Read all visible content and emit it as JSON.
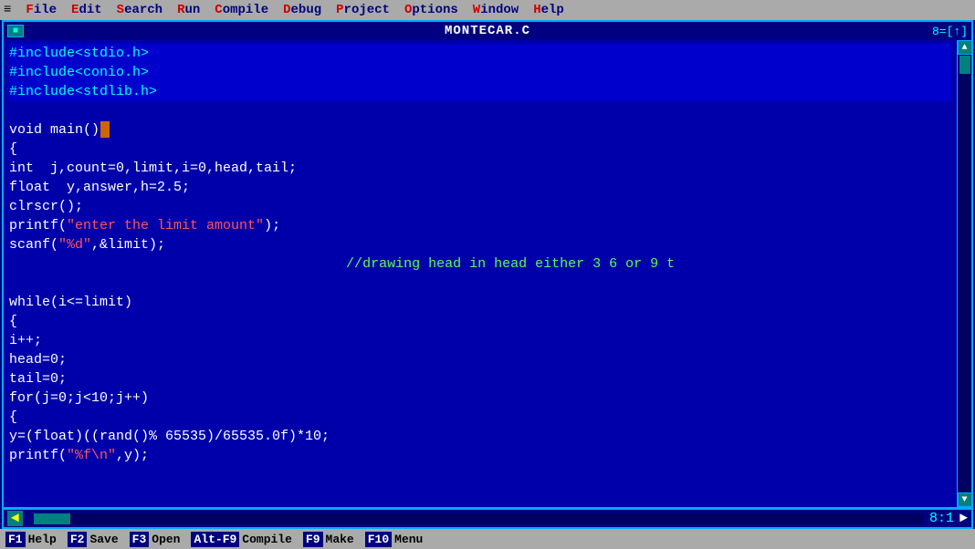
{
  "menubar": {
    "icon": "≡",
    "items": [
      {
        "label": "File",
        "first": "F"
      },
      {
        "label": "Edit",
        "first": "E"
      },
      {
        "label": "Search",
        "first": "S"
      },
      {
        "label": "Run",
        "first": "R"
      },
      {
        "label": "Compile",
        "first": "C"
      },
      {
        "label": "Debug",
        "first": "D"
      },
      {
        "label": "Project",
        "first": "P"
      },
      {
        "label": "Options",
        "first": "O"
      },
      {
        "label": "Window",
        "first": "W"
      },
      {
        "label": "Help",
        "first": "H"
      }
    ]
  },
  "titlebar": {
    "left": "■",
    "title": "MONTECAR.C",
    "right": "8=[↑]"
  },
  "statusbar": {
    "scroll_indicator": "◄",
    "position": "8:1"
  },
  "hotkeybar": {
    "items": [
      {
        "key": "F1",
        "label": "Help"
      },
      {
        "key": "F2",
        "label": "Save"
      },
      {
        "key": "F3",
        "label": "Open"
      },
      {
        "key": "Alt-F9",
        "label": "Compile"
      },
      {
        "key": "F9",
        "label": "Make"
      },
      {
        "key": "F10",
        "label": "Menu"
      }
    ]
  },
  "code": {
    "lines": [
      {
        "type": "include",
        "text": "#include<stdio.h>"
      },
      {
        "type": "include",
        "text": "#include<conio.h>"
      },
      {
        "type": "include",
        "text": "#include<stdlib.h>"
      },
      {
        "type": "blank",
        "text": ""
      },
      {
        "type": "normal",
        "text": "void main()"
      },
      {
        "type": "normal",
        "text": "{"
      },
      {
        "type": "normal",
        "text": "int  j,count=0,limit,i=0,head,tail;"
      },
      {
        "type": "normal",
        "text": "float  y,answer,h=2.5;"
      },
      {
        "type": "normal",
        "text": "clrscr();"
      },
      {
        "type": "string_line",
        "text": "printf(\"enter the limit amount\");"
      },
      {
        "type": "string_line",
        "text": "scanf(\"%d\",&limit);"
      },
      {
        "type": "comment_line",
        "text": "                                         //drawing head in head either 3 6 or 9 t"
      },
      {
        "type": "blank",
        "text": ""
      },
      {
        "type": "normal",
        "text": "while(i<=limit)"
      },
      {
        "type": "normal",
        "text": "{"
      },
      {
        "type": "normal",
        "text": "i++;"
      },
      {
        "type": "normal",
        "text": "head=0;"
      },
      {
        "type": "normal",
        "text": "tail=0;"
      },
      {
        "type": "normal",
        "text": "for(j=0;j<10;j++)"
      },
      {
        "type": "normal",
        "text": "{"
      },
      {
        "type": "normal",
        "text": "y=(float)((rand()% 65535)/65535.0f)*10;"
      },
      {
        "type": "string_line",
        "text": "printf(\"%f\\n\",y);"
      }
    ]
  }
}
